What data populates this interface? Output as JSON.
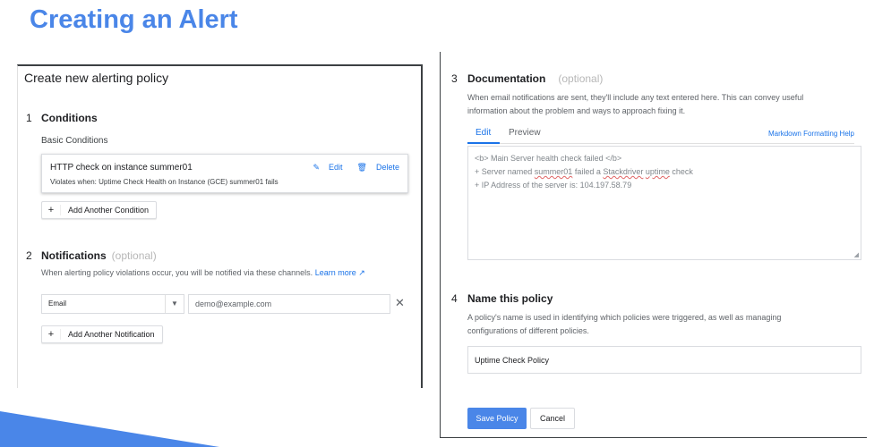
{
  "slide": {
    "title": "Creating an Alert"
  },
  "left": {
    "header": "Create new alerting policy",
    "conditions": {
      "num": "1",
      "title": "Conditions",
      "subtitle": "Basic Conditions",
      "card": {
        "title": "HTTP check on instance summer01",
        "description": "Violates when: Uptime Check Health on Instance (GCE) summer01 fails",
        "edit_label": "Edit",
        "delete_label": "Delete"
      },
      "add_label": "Add Another Condition"
    },
    "notifications": {
      "num": "2",
      "title": "Notifications",
      "optional": "(optional)",
      "description": "When alerting policy violations occur, you will be notified via these channels.",
      "learn_more": "Learn more",
      "channel_type": "Email",
      "email_placeholder": "demo@example.com",
      "remove": "✕",
      "add_label": "Add Another Notification"
    }
  },
  "right": {
    "documentation": {
      "num": "3",
      "title": "Documentation",
      "optional": "(optional)",
      "description_line1": "When email notifications are sent, they'll include any text entered here. This can convey useful",
      "description_line2": "information about the problem and ways to approach fixing it.",
      "tabs": [
        "Edit",
        "Preview"
      ],
      "markdown_help": "Markdown Formatting Help",
      "lines": {
        "l1": "<b> Main Server health check failed </b>",
        "l2_a": "+ Server named ",
        "l2_b": "summer01",
        "l2_c": " failed a ",
        "l2_d": "Stackdriver",
        "l2_e": " ",
        "l2_f": "uptime",
        "l2_g": " check",
        "l3": "+ IP Address of the server is: 104.197.58.79"
      }
    },
    "name_policy": {
      "num": "4",
      "title": "Name this policy",
      "description_line1": "A policy's name is used in identifying which policies were triggered, as well as managing",
      "description_line2": "configurations of different policies.",
      "value": "Uptime Check Policy"
    },
    "buttons": {
      "save": "Save Policy",
      "cancel": "Cancel"
    }
  },
  "colors": {
    "accent": "#4a86e8",
    "link": "#1a73e8"
  }
}
